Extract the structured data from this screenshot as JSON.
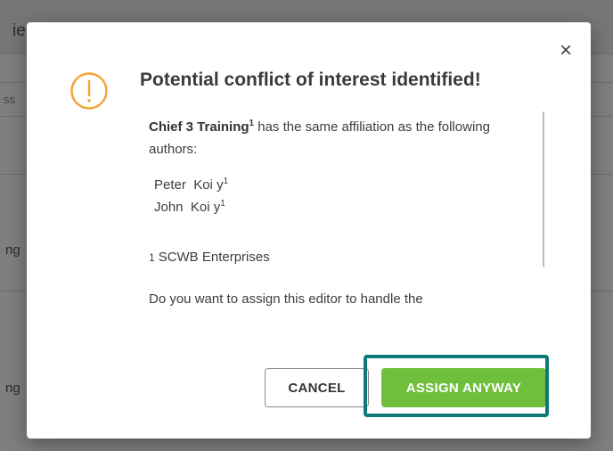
{
  "background": {
    "fragments": [
      "ie",
      "ss",
      "ng",
      "ng"
    ]
  },
  "dialog": {
    "title": "Potential conflict of interest identified!",
    "close_glyph": "×",
    "icon": "warning-exclamation-icon",
    "intro": {
      "editor_name": "Chief 3 Training",
      "editor_sup": "1",
      "text": " has the same affiliation as the following authors:"
    },
    "authors": [
      {
        "first": "Peter",
        "last": "Koi",
        "suffix": "y",
        "sup": "1"
      },
      {
        "first": "John",
        "last": "Koi",
        "suffix": "y",
        "sup": "1"
      }
    ],
    "affiliation": {
      "number": "1",
      "name": "SCWB Enterprises"
    },
    "question": "Do you want to assign this editor to handle the",
    "buttons": {
      "cancel": "CANCEL",
      "assign": "ASSIGN ANYWAY"
    }
  },
  "colors": {
    "warning": "#f3a536",
    "assign_button": "#6fbe3c",
    "highlight_border": "#0c7a78"
  }
}
